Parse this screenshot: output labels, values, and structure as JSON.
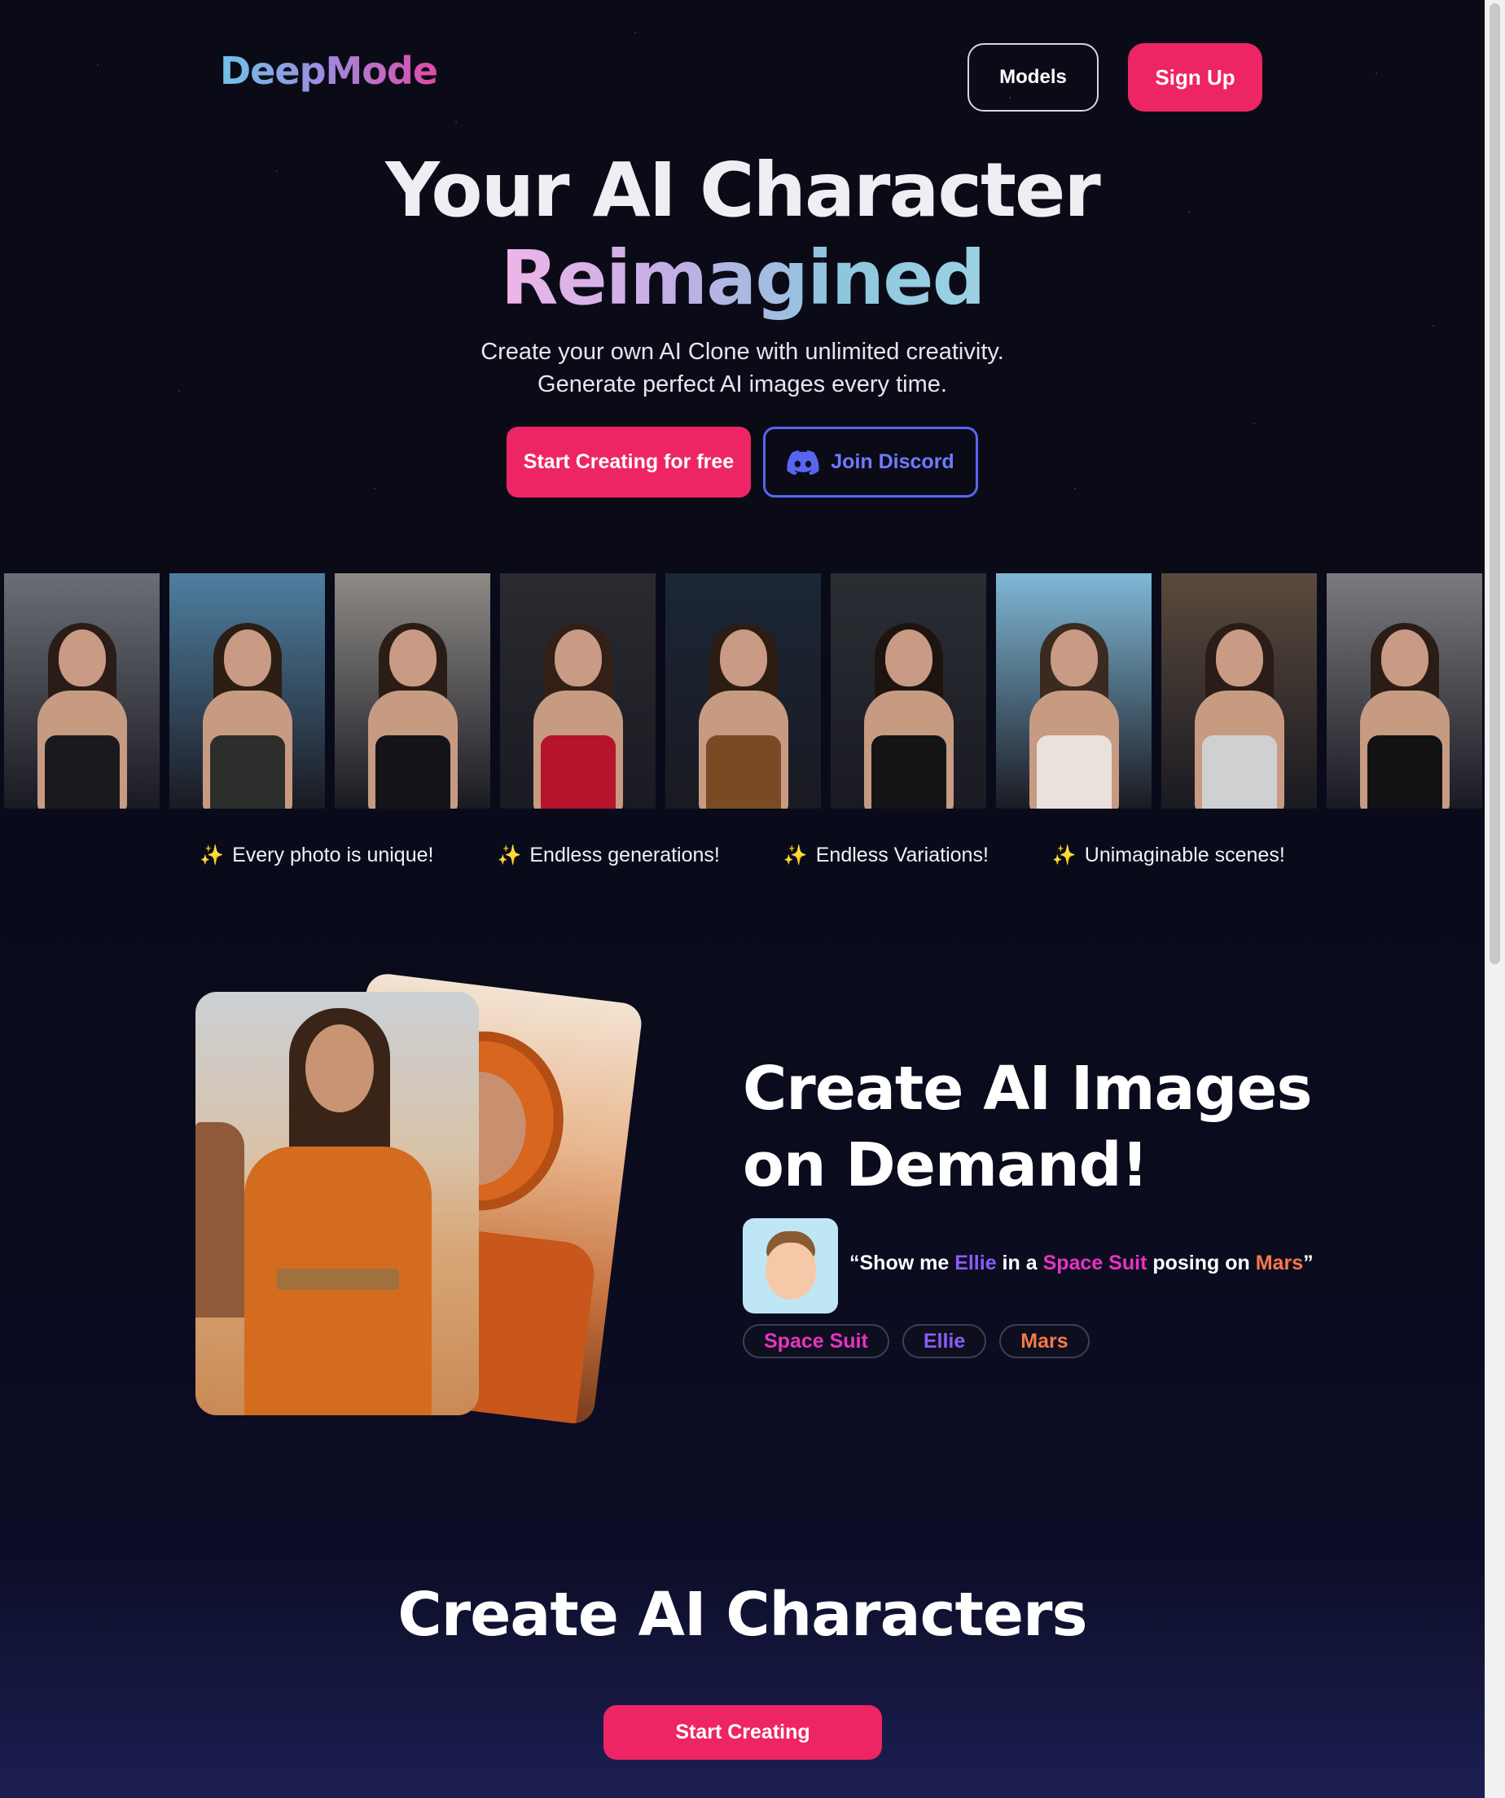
{
  "header": {
    "logo": "DeepMode",
    "models_label": "Models",
    "signup_label": "Sign Up"
  },
  "hero": {
    "title_line1": "Your AI Character",
    "title_line2": "Reimagined",
    "subtitle_line1": "Create your own AI Clone with unlimited creativity.",
    "subtitle_line2": "Generate perfect AI images every time.",
    "primary_cta": "Start Creating for free",
    "discord_cta": "Join Discord"
  },
  "gallery": {
    "cards": [
      {
        "bg": "#6b6e74",
        "hair": "#2a1c16",
        "outfit": "#1a1a1e"
      },
      {
        "bg": "#4f7fa0",
        "hair": "#2c1d15",
        "outfit": "#2b2e2a"
      },
      {
        "bg": "#8e8a86",
        "hair": "#2a1c16",
        "outfit": "#141418"
      },
      {
        "bg": "#2a2a30",
        "hair": "#321f16",
        "outfit": "#b5142a"
      },
      {
        "bg": "#1b2636",
        "hair": "#2c1c14",
        "outfit": "#7a4a24"
      },
      {
        "bg": "#2a2e33",
        "hair": "#1d1410",
        "outfit": "#141416"
      },
      {
        "bg": "#7fb8d6",
        "hair": "#3a2a1f",
        "outfit": "#e9e2dc"
      },
      {
        "bg": "#5a4a3c",
        "hair": "#2a1c16",
        "outfit": "#cfd0d2"
      },
      {
        "bg": "#7a7a80",
        "hair": "#2a1c16",
        "outfit": "#121214"
      }
    ]
  },
  "features": [
    {
      "icon": "sparkles-icon",
      "label": "Every photo is unique!"
    },
    {
      "icon": "sparkles-icon",
      "label": "Endless generations!"
    },
    {
      "icon": "sparkles-icon",
      "label": "Endless Variations!"
    },
    {
      "icon": "sparkles-icon",
      "label": "Unimaginable scenes!"
    }
  ],
  "demand": {
    "title": "Create AI Images on Demand!",
    "prompt_open": "“Show me ",
    "prompt_name": "Ellie",
    "prompt_mid1": " in a ",
    "prompt_item": "Space Suit",
    "prompt_mid2": " posing on ",
    "prompt_place": "Mars",
    "prompt_close": "”",
    "tags": [
      {
        "label": "Space Suit",
        "color": "#e833c0"
      },
      {
        "label": "Ellie",
        "color": "#8b5cf6"
      },
      {
        "label": "Mars",
        "color": "#f97847"
      }
    ]
  },
  "characters": {
    "title": "Create AI Characters",
    "cta": "Start Creating"
  },
  "colors": {
    "accent": "#ee2564",
    "discord": "#5865f2",
    "background": "#0a0b1a"
  }
}
